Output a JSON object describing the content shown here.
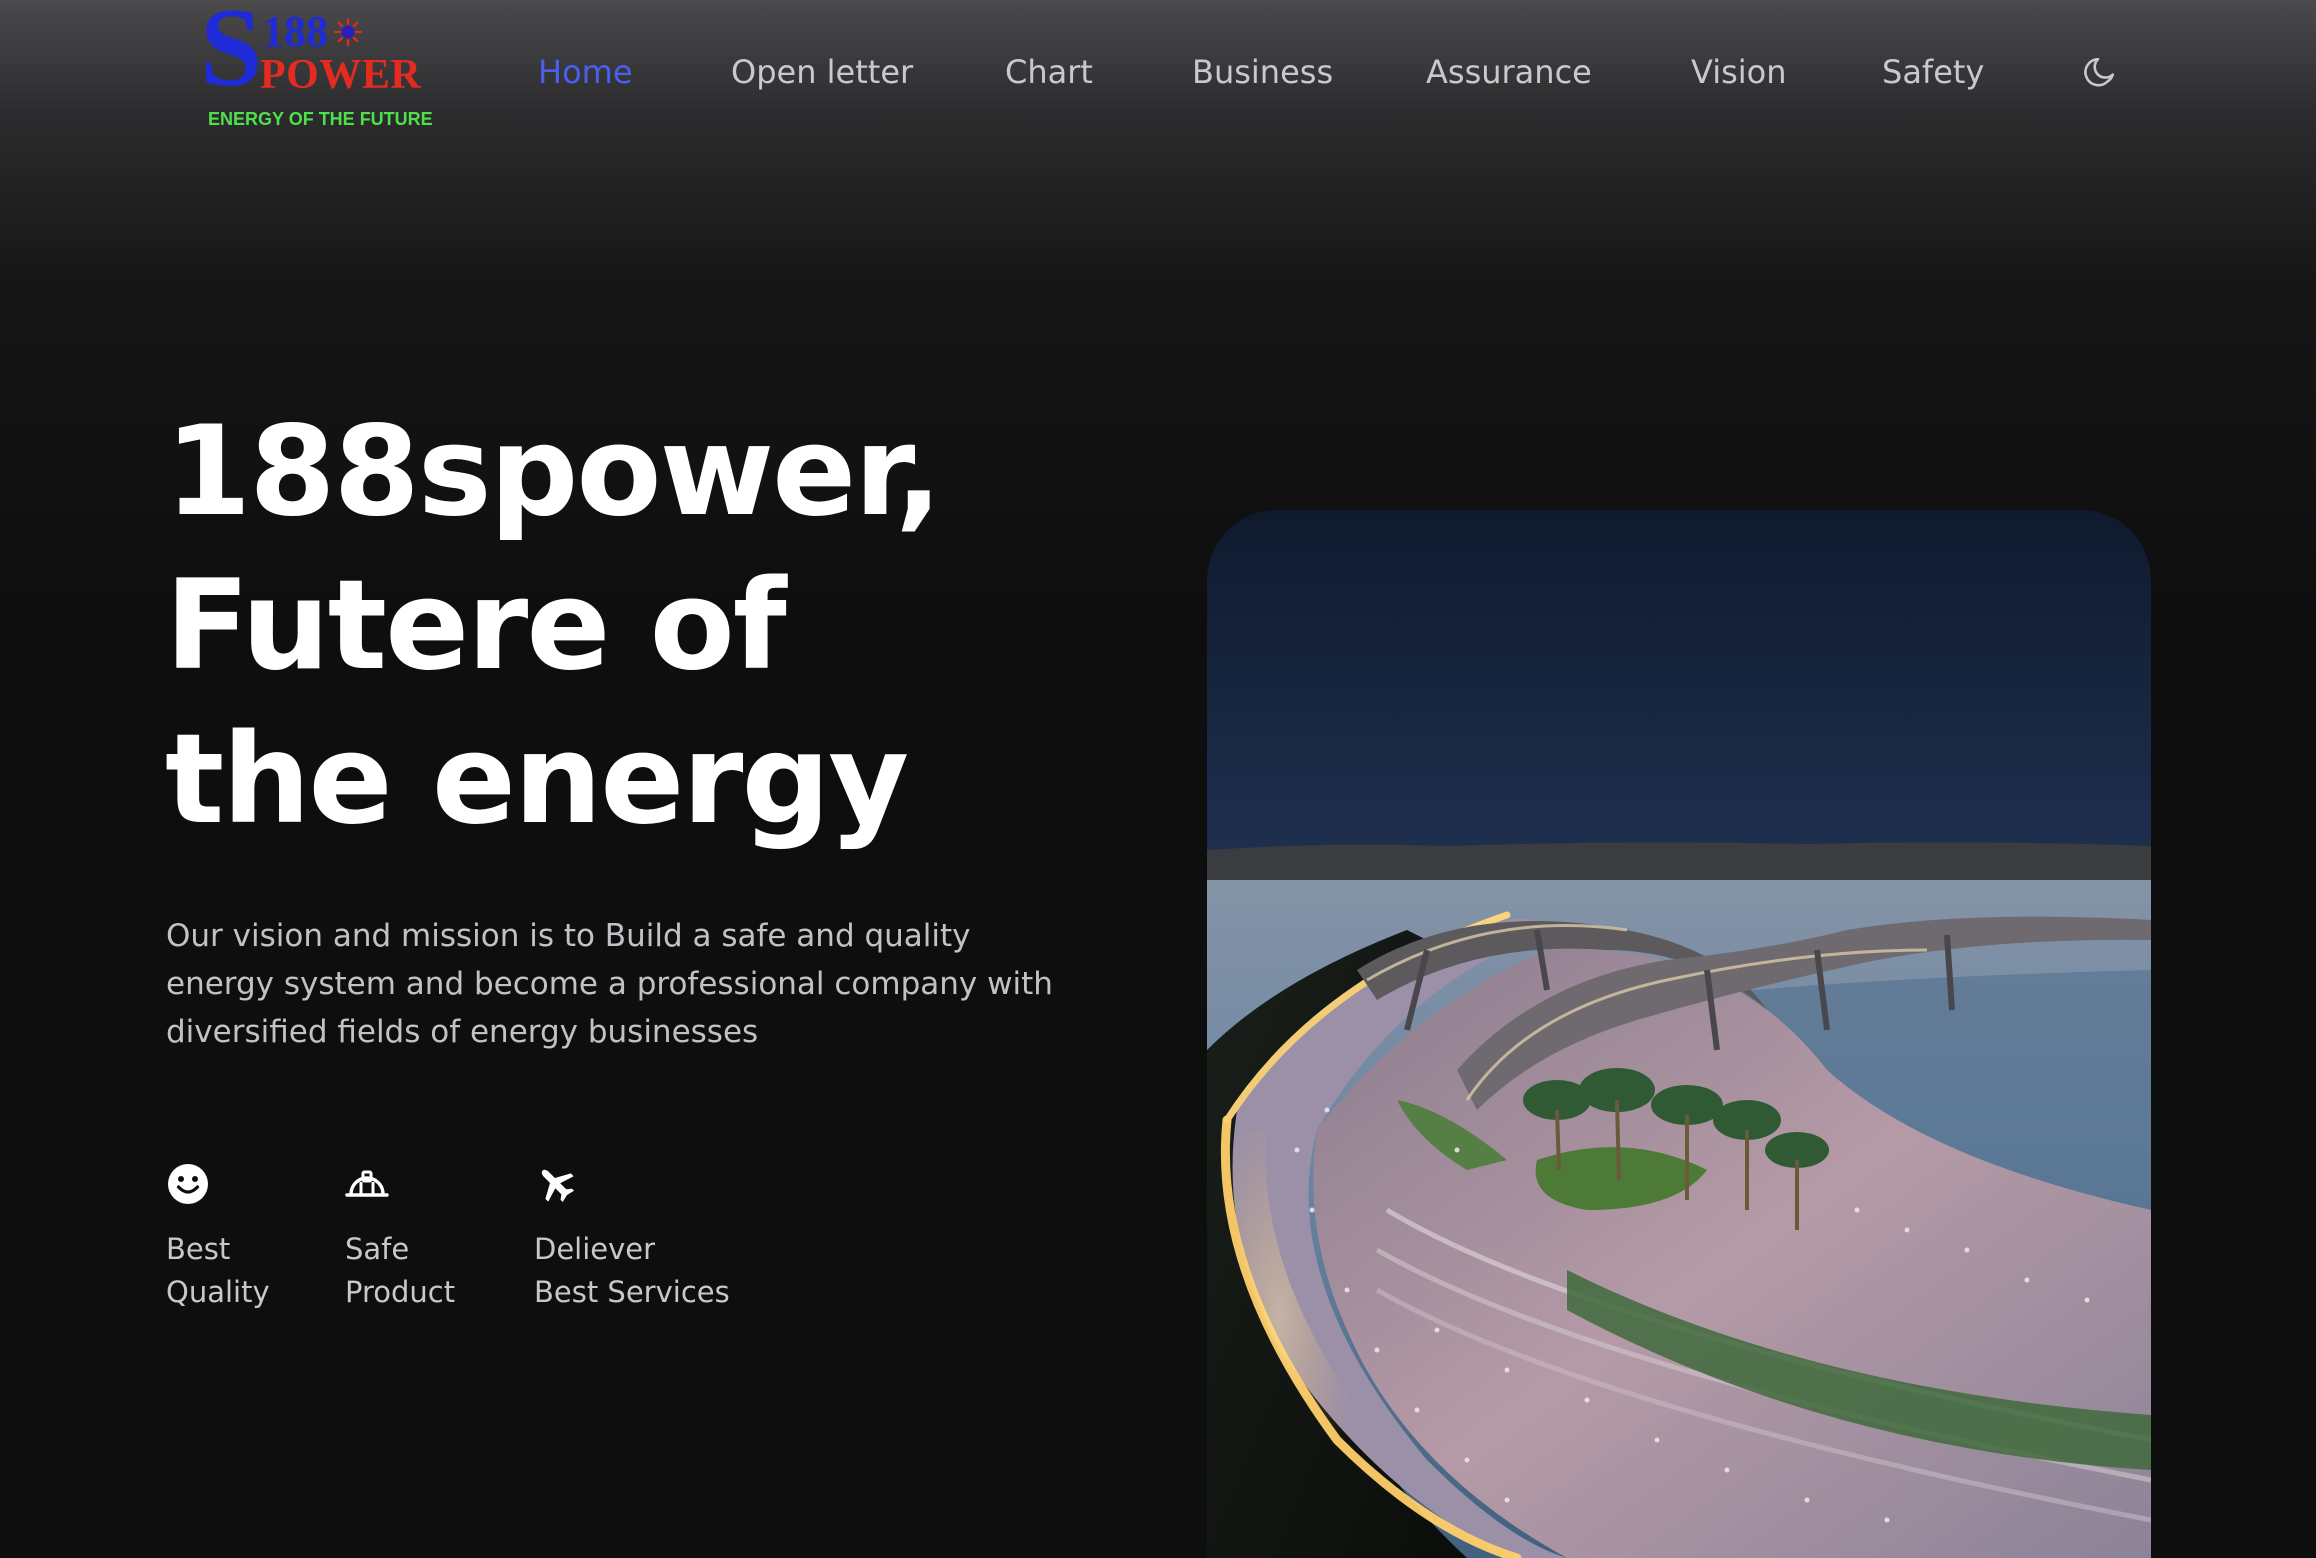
{
  "header": {
    "logo": {
      "letter": "S",
      "number": "188",
      "word": "POWER",
      "tagline": "ENERGY OF THE FUTURE"
    },
    "nav": [
      {
        "label": "Home",
        "active": true
      },
      {
        "label": "Open letter",
        "active": false
      },
      {
        "label": "Chart",
        "active": false
      },
      {
        "label": "Business",
        "active": false
      },
      {
        "label": "Assurance",
        "active": false
      },
      {
        "label": "Vision",
        "active": false
      },
      {
        "label": "Safety",
        "active": false
      }
    ],
    "theme_toggle_icon": "moon-icon"
  },
  "hero": {
    "title_lines": [
      "188spower,",
      "Futere of",
      "the energy"
    ],
    "description": "Our vision and mission is to Build a safe and quality energy system and become a professional company with diversified fields of energy businesses",
    "features": [
      {
        "icon": "smile-icon",
        "line1": "Best",
        "line2": "Quality"
      },
      {
        "icon": "hard-hat-icon",
        "line1": "Safe",
        "line2": "Product"
      },
      {
        "icon": "airplane-icon",
        "line1": "Deliever",
        "line2": "Best Services"
      }
    ]
  },
  "colors": {
    "background": "#0e0e0f",
    "nav_active": "#4a5ef0",
    "nav_text": "#c9c9cc",
    "logo_blue": "#1f2bd6",
    "logo_red": "#e32b1f",
    "logo_green": "#4ee04a"
  }
}
